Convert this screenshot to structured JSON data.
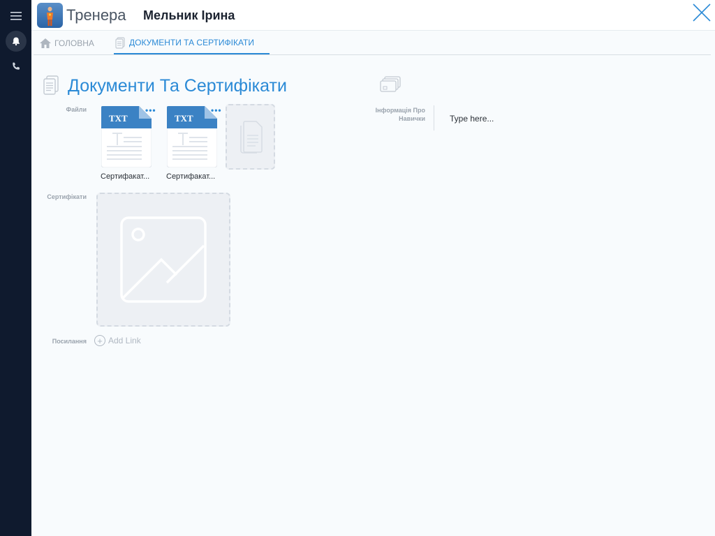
{
  "header": {
    "app_name": "Тренера",
    "person_name": "Мельник Ірина"
  },
  "tabs": [
    {
      "label": "ГОЛОВНА",
      "icon": "home-icon",
      "active": false
    },
    {
      "label": "ДОКУМЕНТИ ТА СЕРТИФІКАТИ",
      "icon": "document-icon",
      "active": true
    }
  ],
  "section": {
    "title": "Документи Та Сертифікати"
  },
  "fields": {
    "files_label": "Файли",
    "certificates_label": "Сертифікати",
    "links_label": "Посилання",
    "info_label": "Інформація Про Навички"
  },
  "files": [
    {
      "type": "TXT",
      "name": "Сертифакат..."
    },
    {
      "type": "TXT",
      "name": "Сертифакат..."
    }
  ],
  "add_link": {
    "label": "Add Link"
  },
  "info": {
    "placeholder": "Type here..."
  },
  "colors": {
    "accent": "#2b8ad6",
    "rail": "#0f1a2e",
    "file_header": "#3b82c4"
  }
}
